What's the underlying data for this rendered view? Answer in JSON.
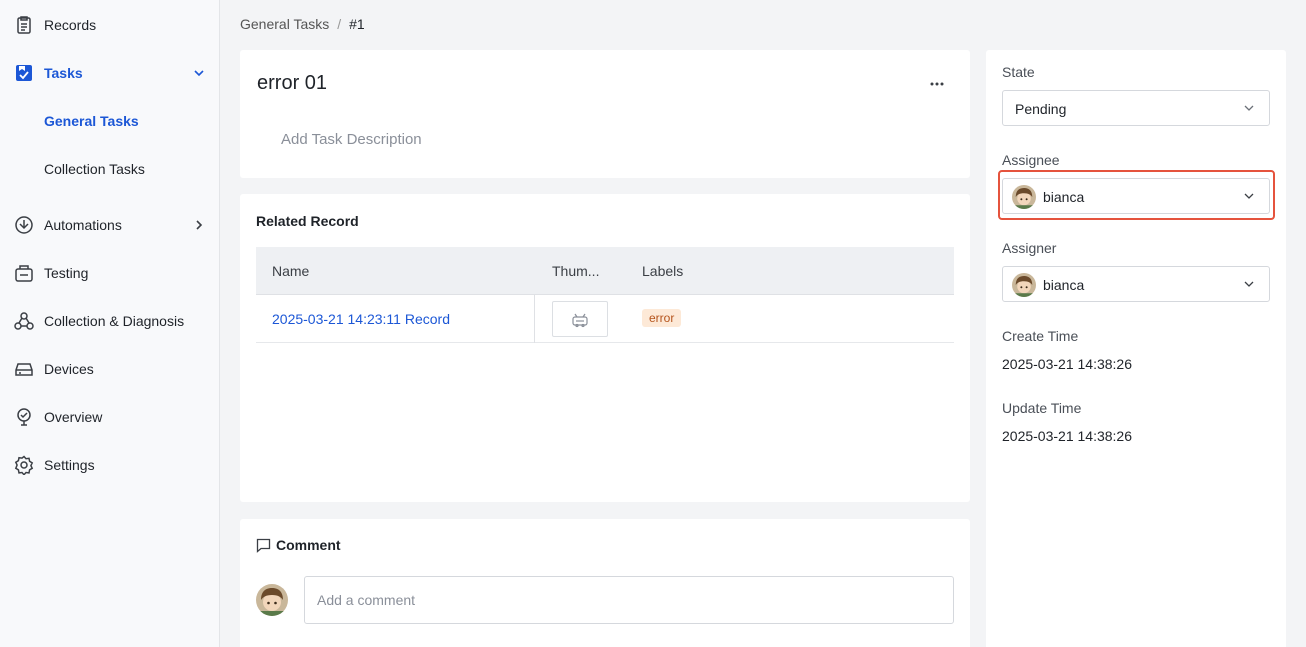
{
  "sidebar": {
    "items": [
      {
        "label": "Records",
        "icon": "records-icon"
      },
      {
        "label": "Tasks",
        "icon": "tasks-icon"
      },
      {
        "label": "General Tasks"
      },
      {
        "label": "Collection Tasks"
      },
      {
        "label": "Automations",
        "icon": "automations-icon"
      },
      {
        "label": "Testing",
        "icon": "testing-icon"
      },
      {
        "label": "Collection & Diagnosis",
        "icon": "diagnosis-icon"
      },
      {
        "label": "Devices",
        "icon": "devices-icon"
      },
      {
        "label": "Overview",
        "icon": "overview-icon"
      },
      {
        "label": "Settings",
        "icon": "settings-icon"
      }
    ]
  },
  "breadcrumb": {
    "parent": "General Tasks",
    "separator": "/",
    "current": "#1"
  },
  "task": {
    "title": "error 01",
    "description_placeholder": "Add Task Description"
  },
  "related": {
    "title": "Related Record",
    "columns": [
      "Name",
      "Thum...",
      "Labels"
    ],
    "rows": [
      {
        "name": "2025-03-21 14:23:11 Record",
        "label": "error"
      }
    ]
  },
  "comment": {
    "title": "Comment",
    "placeholder": "Add a comment"
  },
  "details": {
    "state_label": "State",
    "state_value": "Pending",
    "assignee_label": "Assignee",
    "assignee_value": "bianca",
    "assigner_label": "Assigner",
    "assigner_value": "bianca",
    "create_label": "Create Time",
    "create_value": "2025-03-21 14:38:26",
    "update_label": "Update Time",
    "update_value": "2025-03-21 14:38:26"
  },
  "colors": {
    "accent": "#1c57d6",
    "highlight": "#e5533d",
    "tag_bg": "#fde9d7",
    "tag_text": "#b5541c"
  }
}
